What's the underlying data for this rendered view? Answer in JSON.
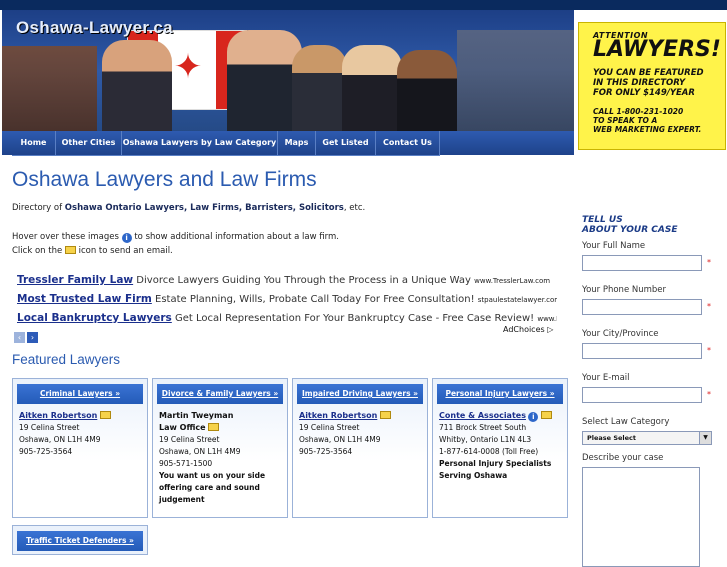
{
  "header": {
    "logo_text": "Oshawa-Lawyer.ca",
    "ad": {
      "attention": "ATTENTION",
      "lawyers": "LAWYERS!",
      "line1": "YOU CAN BE FEATURED",
      "line2": "IN THIS DIRECTORY",
      "line3": "FOR ONLY $149/YEAR",
      "call1": "CALL 1-800-231-1020",
      "call2": "TO SPEAK TO A",
      "call3": "WEB MARKETING EXPERT."
    }
  },
  "nav": {
    "items": [
      "Home",
      "Other Cities",
      "Oshawa Lawyers by Law Category",
      "Maps",
      "Get Listed",
      "Contact Us"
    ]
  },
  "page": {
    "title": "Oshawa Lawyers and Law Firms",
    "intro_prefix": "Directory of ",
    "intro_bold": "Oshawa Ontario Lawyers, Law Firms, Barristers, Solicitors",
    "intro_suffix": ", etc.",
    "hover_a": "Hover over these images",
    "hover_b": "to show additional information about a law firm.",
    "click_a": "Click on the",
    "click_b": "icon to send an email."
  },
  "ads": [
    {
      "title": "Tressler Family Law",
      "text": " Divorce Lawyers Guiding You Through the Process in a Unique Way ",
      "url": "www.TresslerLaw.com"
    },
    {
      "title": "Most Trusted Law Firm",
      "text": " Estate Planning, Wills, Probate Call Today For Free Consultation! ",
      "url": "stpaulestatelawyer.com/"
    },
    {
      "title": "Local Bankruptcy Lawyers",
      "text": " Get Local Representation For Your Bankruptcy Case - Free Case Review! ",
      "url": "www.Bankr..."
    }
  ],
  "adchoices": "AdChoices",
  "featured": {
    "heading": "Featured Lawyers",
    "cards": [
      {
        "head": "Criminal Lawyers »",
        "name": "Aitken Robertson",
        "lines": [
          "19 Celina Street",
          "Oshawa, ON L1H 4M9",
          "905-725-3564"
        ],
        "extra": []
      },
      {
        "head": "Divorce & Family Lawyers »",
        "name": "Martin Tweyman",
        "firm": "Law Office",
        "lines": [
          "19 Celina Street",
          "Oshawa, ON L1H 4M9",
          "905-571-1500"
        ],
        "extra": [
          "You want us on your side",
          "offering care and sound",
          "judgement"
        ]
      },
      {
        "head": "Impaired Driving Lawyers »",
        "name": "Aitken Robertson",
        "lines": [
          "19 Celina Street",
          "Oshawa, ON L1H 4M9",
          "905-725-3564"
        ],
        "extra": []
      },
      {
        "head": "Personal Injury Lawyers »",
        "name": "Conte & Associates",
        "lines": [
          "711 Brock Street South",
          "Whitby, Ontario L1N 4L3",
          "1-877-614-0008 (Toll Free)"
        ],
        "extra": [
          "Personal Injury Specialists",
          "Serving Oshawa"
        ]
      }
    ],
    "card5_head": "Traffic Ticket Defenders »"
  },
  "sidebar": {
    "title1": "TELL US",
    "title2": "ABOUT YOUR CASE",
    "full_name": "Your Full Name",
    "phone": "Your Phone Number",
    "city": "Your City/Province",
    "email": "Your E-mail",
    "category": "Select Law Category",
    "category_selected": "Please Select",
    "describe": "Describe your case",
    "required_mark": "*"
  }
}
